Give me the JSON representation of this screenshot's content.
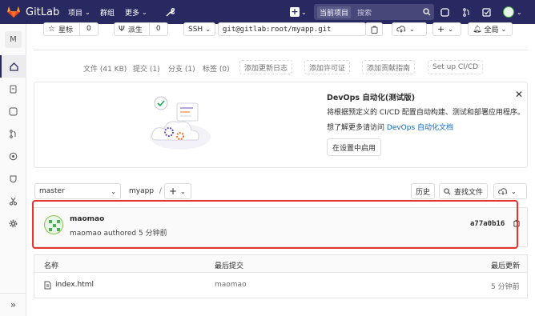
{
  "topbar": {
    "brand": "GitLab",
    "nav": [
      "项目",
      "群组",
      "更多"
    ],
    "search_scope": "当前项目",
    "search_placeholder": "搜索"
  },
  "sidebar": {
    "avatar_letter": "M"
  },
  "project_actions": {
    "star_label": "星标",
    "star_count": "0",
    "fork_label": "派生",
    "fork_count": "0",
    "clone_protocol": "SSH",
    "clone_url": "git@gitlab:root/myapp.git",
    "notification": "全局"
  },
  "stats": {
    "files": "文件 (41 KB)",
    "commits": "提交 (1)",
    "branches": "分支 (1)",
    "tags": "标签 (0)",
    "add_changelog": "添加更新日志",
    "add_license": "添加许可证",
    "add_contributing": "添加贡献指南",
    "setup_cicd": "Set up CI/CD"
  },
  "devops_banner": {
    "title": "DevOps 自动化(测试版)",
    "desc": "将根据预定义的 CI/CD 配置自动构建、测试和部署应用程序。",
    "learn_prefix": "想了解更多请访问",
    "learn_link": "DevOps 自动化文档",
    "enable_button": "在设置中启用"
  },
  "repo_nav": {
    "branch": "master",
    "path": "myapp",
    "separator": "/",
    "history": "历史",
    "find_file": "查找文件"
  },
  "last_commit": {
    "title": "maomao",
    "meta": "maomao authored 5 分钟前",
    "sha": "a77a0b16"
  },
  "file_table": {
    "headers": [
      "名称",
      "最后提交",
      "最后更新"
    ],
    "rows": [
      {
        "name": "index.html",
        "commit": "maomao",
        "updated": "5 分钟前"
      }
    ]
  }
}
